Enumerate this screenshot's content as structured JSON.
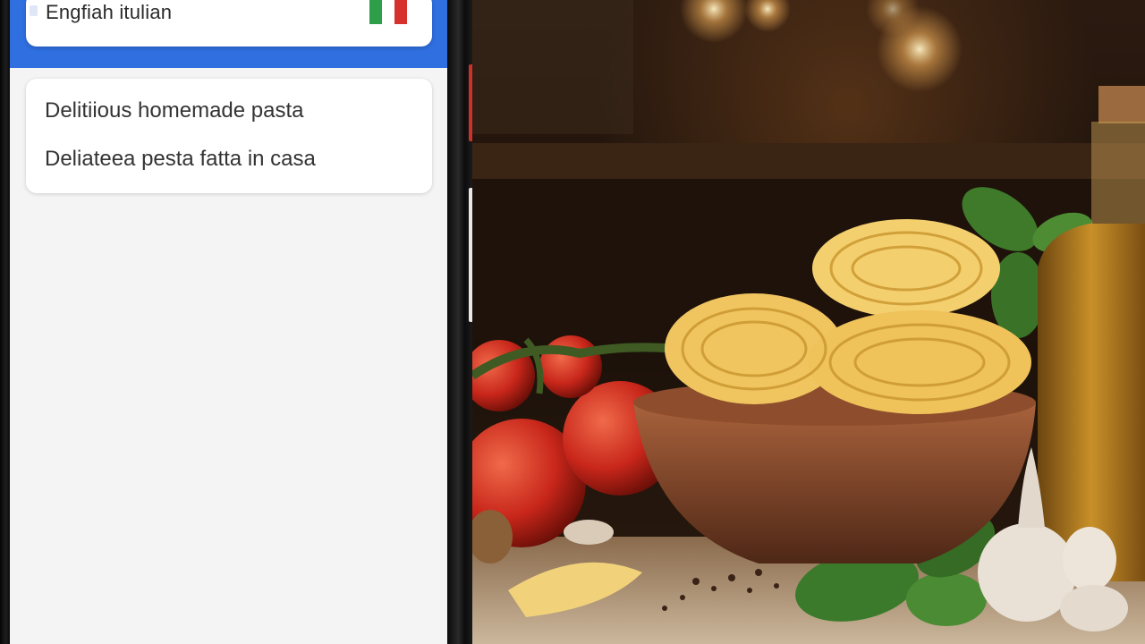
{
  "language_selector": {
    "label": "Engfiah itulian",
    "flag_icon": "italian-flag-icon",
    "flag_colors": [
      "#2e9e4a",
      "#ffffff",
      "#d6312c"
    ]
  },
  "translation_card": {
    "source_text": "Delitiious homemade pasta",
    "translated_text": "Deliateea pesta fatta in casa"
  },
  "colors": {
    "header_blue": "#2f6fe0",
    "screen_background": "#f4f4f5"
  }
}
